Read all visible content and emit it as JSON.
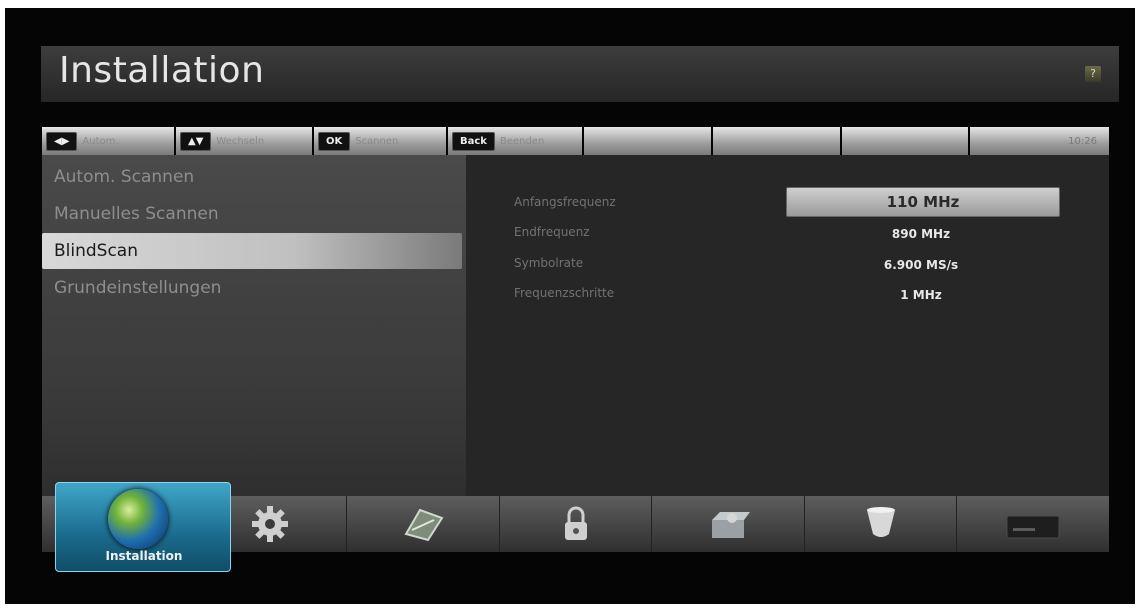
{
  "window": {
    "title": "Installation",
    "help_icon": "?"
  },
  "hints": [
    {
      "key": "◀▶",
      "label": "Autom."
    },
    {
      "key": "▲▼",
      "label": "Wechseln"
    },
    {
      "key": "OK",
      "label": "Scannen"
    },
    {
      "key": "Back",
      "label": "Beenden"
    }
  ],
  "clock": "10:26",
  "menu": {
    "items": [
      {
        "label": "Autom. Scannen"
      },
      {
        "label": "Manuelles Scannen"
      },
      {
        "label": "BlindScan"
      },
      {
        "label": "Grundeinstellungen"
      }
    ],
    "selected_index": 2
  },
  "params": [
    {
      "label": "Anfangsfrequenz",
      "value": "110 MHz"
    },
    {
      "label": "Endfrequenz",
      "value": "890 MHz"
    },
    {
      "label": "Symbolrate",
      "value": "6.900 MS/s"
    },
    {
      "label": "Frequenzschritte",
      "value": "1 MHz"
    }
  ],
  "nav": {
    "active_label": "Installation",
    "icons": [
      "globe-icon",
      "gear-icon",
      "tools-icon",
      "lock-icon",
      "settings-box-icon",
      "cup-icon",
      "receiver-icon"
    ]
  },
  "colors": {
    "accent": "#2a8fb5",
    "selected": "#cfcfcf",
    "background": "#050505"
  }
}
